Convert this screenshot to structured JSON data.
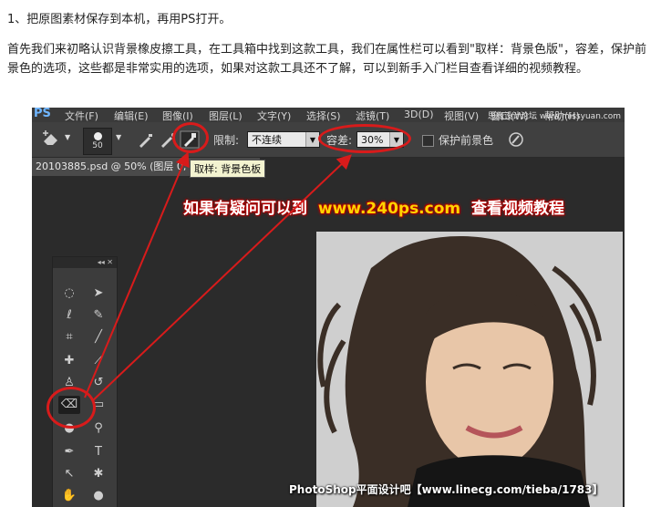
{
  "step": "1、把原图素材保存到本机，再用PS打开。",
  "paragraph": "首先我们来初略认识背景橡皮擦工具，在工具箱中找到这款工具，我们在属性栏可以看到\"取样：背景色版\"，容差，保护前景色的选项，这些都是非常实用的选项，如果对这款工具还不了解，可以到新手入门栏目查看详细的视频教程。",
  "screenshot": {
    "app_logo": "PS",
    "menu": [
      "文件(F)",
      "编辑(E)",
      "图像(I)",
      "图层(L)",
      "文字(Y)",
      "选择(S)",
      "滤镜(T)",
      "3D(D)",
      "视图(V)",
      "窗口(W)",
      "帮助(H)"
    ],
    "watermark": "思缘设计论坛 www.missyuan.com",
    "options": {
      "brush_size": "50",
      "limit_label": "限制:",
      "limit_value": "不连续",
      "tolerance_label": "容差:",
      "tolerance_value": "30%",
      "protect_label": "保护前景色"
    },
    "doc_tab": "20103885.psd @ 50% (图层 0, 图",
    "tooltip": "取样: 背景色板",
    "hint_prefix": "如果有疑问可以到",
    "hint_url": "www.240ps.com",
    "hint_suffix": "查看视频教程",
    "toolbox_header": "◂◂ ✕",
    "credit": "PhotoShop平面设计吧【www.linecg.com/tieba/1783】"
  },
  "colors": {
    "highlight_red": "#d81b1b",
    "hint_url": "#ffd400"
  }
}
